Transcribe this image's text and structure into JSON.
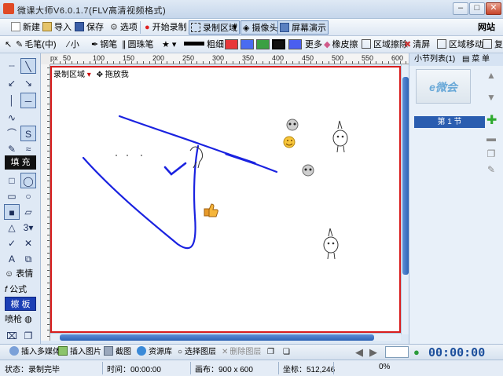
{
  "window": {
    "title": "微课大师V6.0.1.7(FLV高清视频格式)"
  },
  "toolbar1": {
    "new": "新建",
    "import": "导入",
    "save": "保存",
    "options": "选项",
    "start_record": "开始录制",
    "record_area": "录制区域",
    "camera": "摄像头",
    "screen_demo": "屏幕演示",
    "website": "网站"
  },
  "toolbar2": {
    "brush": "毛笔(中)",
    "small": "小",
    "pen": "钢笔",
    "ballpoint": "圆珠笔",
    "thickness": "粗细",
    "more": "更多",
    "eraser": "橡皮擦",
    "area_erase": "区域擦除",
    "clear": "清屏",
    "area_move": "区域移动",
    "overflow": "复",
    "colors": [
      "#e8383a",
      "#4a6cf0",
      "#3ba043",
      "#111111",
      "#4a5ff0"
    ]
  },
  "left": {
    "fill": "填 充",
    "count": "3",
    "formula_label": "表情",
    "formula": "公式",
    "blackboard": "檫 板",
    "spray": "喷枪"
  },
  "canvas": {
    "record_area": "录制区域",
    "drag": "拖放我",
    "h_ticks": [
      "px",
      "50",
      "100",
      "150",
      "200",
      "250",
      "300",
      "350",
      "400",
      "450",
      "500",
      "550",
      "600"
    ]
  },
  "right": {
    "list": "小节列表(1)",
    "menu": "菜 单",
    "thumb_text": "e微会",
    "section": "第 1 节"
  },
  "bottom": {
    "insert_media": "插入多媒体",
    "insert_image": "插入图片",
    "screenshot": "截图",
    "resource": "资源库",
    "select_layer": "选择图层",
    "delete_layer": "删除图层",
    "timer": "00:00:00"
  },
  "status": {
    "state": "状态：录制完毕",
    "time": "时间：00:00:00",
    "canvas": "画布：900 x 600",
    "coords": "坐标：512,246",
    "percent": "0%"
  }
}
